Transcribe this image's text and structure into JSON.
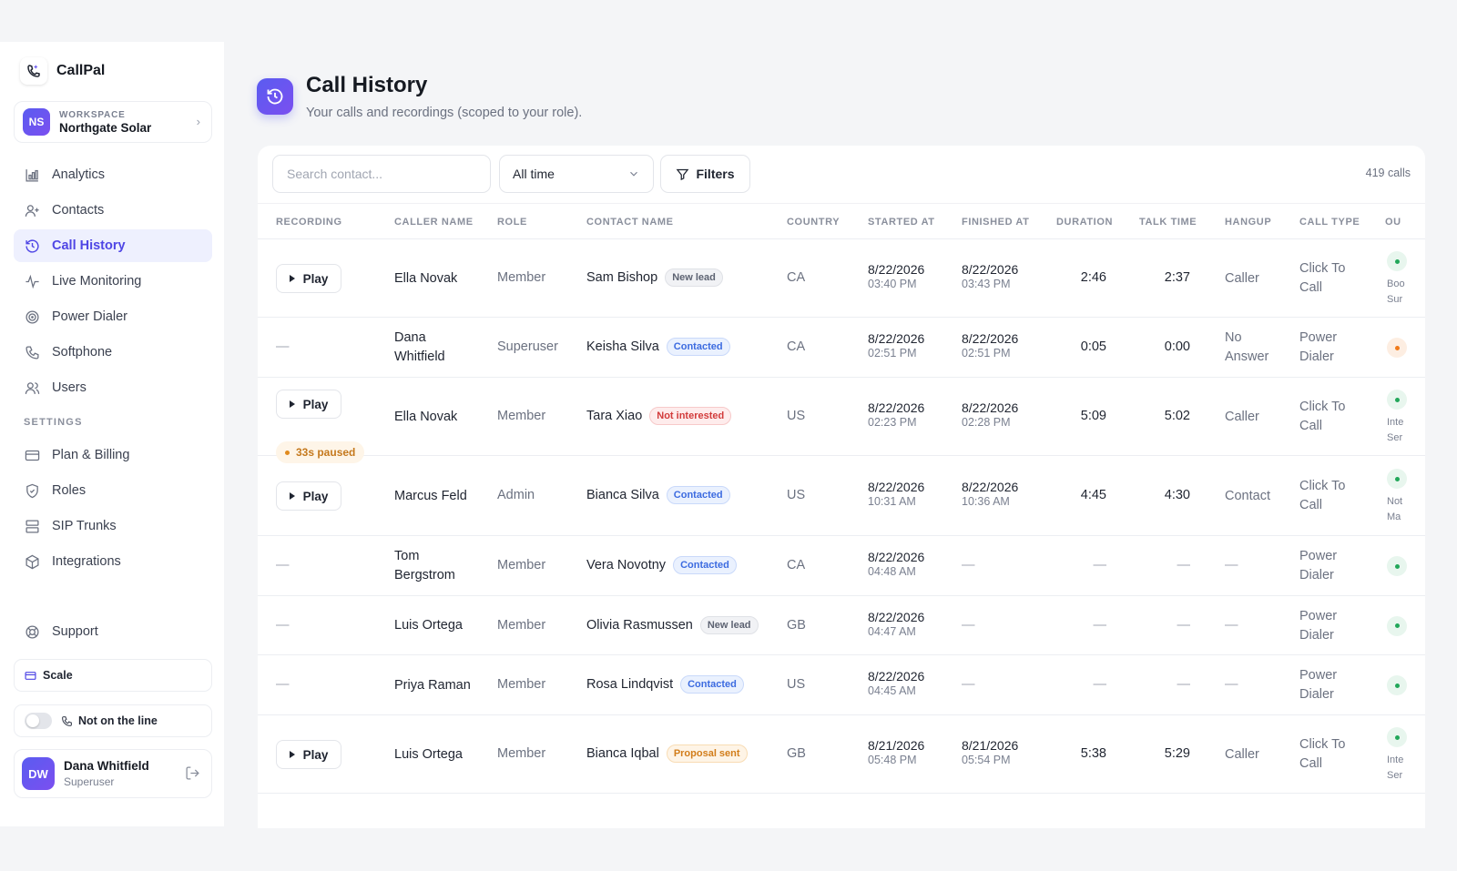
{
  "app": {
    "name": "CallPal"
  },
  "workspace": {
    "label": "WORKSPACE",
    "name": "Northgate Solar",
    "initials": "NS"
  },
  "nav": [
    {
      "label": "Analytics",
      "icon": "bar-chart-icon"
    },
    {
      "label": "Contacts",
      "icon": "user-plus-icon"
    },
    {
      "label": "Call History",
      "icon": "history-icon",
      "active": true
    },
    {
      "label": "Live Monitoring",
      "icon": "activity-icon"
    },
    {
      "label": "Power Dialer",
      "icon": "target-icon"
    },
    {
      "label": "Softphone",
      "icon": "phone-icon"
    },
    {
      "label": "Users",
      "icon": "users-icon"
    }
  ],
  "settings_label": "SETTINGS",
  "settings_nav": [
    {
      "label": "Plan & Billing",
      "icon": "credit-card-icon"
    },
    {
      "label": "Roles",
      "icon": "shield-icon"
    },
    {
      "label": "SIP Trunks",
      "icon": "server-icon"
    },
    {
      "label": "Integrations",
      "icon": "box-icon"
    }
  ],
  "support": {
    "label": "Support"
  },
  "plan": {
    "label": "Scale"
  },
  "status": {
    "label": "Not on the line"
  },
  "user": {
    "initials": "DW",
    "name": "Dana Whitfield",
    "role": "Superuser"
  },
  "header": {
    "title": "Call History",
    "subtitle": "Your calls and recordings (scoped to your role)."
  },
  "toolbar": {
    "search_placeholder": "Search contact...",
    "time_filter": "All time",
    "filters_label": "Filters",
    "count": "419 calls"
  },
  "columns": [
    "RECORDING",
    "CALLER NAME",
    "ROLE",
    "CONTACT NAME",
    "COUNTRY",
    "STARTED AT",
    "FINISHED AT",
    "DURATION",
    "TALK TIME",
    "HANGUP",
    "CALL TYPE",
    "OU"
  ],
  "play_label": "Play",
  "dash": "—",
  "rows": [
    {
      "recording": "play",
      "caller": [
        "Ella Novak"
      ],
      "role": "Member",
      "contact": "Sam Bishop",
      "badge": "New lead",
      "badge_kind": "new",
      "country": "CA",
      "started": [
        "8/22/2026",
        "03:40 PM"
      ],
      "finished": [
        "8/22/2026",
        "03:43 PM"
      ],
      "duration": "2:46",
      "talk": "2:37",
      "hangup": [
        "Caller"
      ],
      "type": [
        "Click To",
        "Call"
      ],
      "ou_dot": "#22a75a",
      "ou_text": [
        "Boo",
        "Sur"
      ]
    },
    {
      "recording": "none",
      "caller": [
        "Dana",
        "Whitfield"
      ],
      "role": "Superuser",
      "contact": "Keisha Silva",
      "badge": "Contacted",
      "badge_kind": "contacted",
      "country": "CA",
      "started": [
        "8/22/2026",
        "02:51 PM"
      ],
      "finished": [
        "8/22/2026",
        "02:51 PM"
      ],
      "duration": "0:05",
      "talk": "0:00",
      "hangup": [
        "No",
        "Answer"
      ],
      "type": [
        "Power",
        "Dialer"
      ],
      "ou_dot": "#f07a1a",
      "ou_text": []
    },
    {
      "recording": "play",
      "paused": "33s paused",
      "caller": [
        "Ella Novak"
      ],
      "role": "Member",
      "contact": "Tara Xiao",
      "badge": "Not interested",
      "badge_kind": "not",
      "country": "US",
      "started": [
        "8/22/2026",
        "02:23 PM"
      ],
      "finished": [
        "8/22/2026",
        "02:28 PM"
      ],
      "duration": "5:09",
      "talk": "5:02",
      "hangup": [
        "Caller"
      ],
      "type": [
        "Click To",
        "Call"
      ],
      "ou_dot": "#22a75a",
      "ou_text": [
        "Inte",
        "Ser"
      ]
    },
    {
      "recording": "play",
      "caller": [
        "Marcus Feld"
      ],
      "role": "Admin",
      "contact": "Bianca Silva",
      "badge": "Contacted",
      "badge_kind": "contacted",
      "country": "US",
      "started": [
        "8/22/2026",
        "10:31 AM"
      ],
      "finished": [
        "8/22/2026",
        "10:36 AM"
      ],
      "duration": "4:45",
      "talk": "4:30",
      "hangup": [
        "Contact"
      ],
      "type": [
        "Click To",
        "Call"
      ],
      "ou_dot": "#22a75a",
      "ou_text": [
        "Not",
        "Ma"
      ]
    },
    {
      "recording": "none",
      "caller": [
        "Tom",
        "Bergstrom"
      ],
      "role": "Member",
      "contact": "Vera Novotny",
      "badge": "Contacted",
      "badge_kind": "contacted",
      "country": "CA",
      "started": [
        "8/22/2026",
        "04:48 AM"
      ],
      "finished": null,
      "duration": null,
      "talk": null,
      "hangup": null,
      "type": [
        "Power",
        "Dialer"
      ],
      "ou_dot": "#22a75a",
      "ou_text": []
    },
    {
      "recording": "none",
      "caller": [
        "Luis Ortega"
      ],
      "role": "Member",
      "contact": "Olivia Rasmussen",
      "badge": "New lead",
      "badge_kind": "new",
      "country": "GB",
      "started": [
        "8/22/2026",
        "04:47 AM"
      ],
      "finished": null,
      "duration": null,
      "talk": null,
      "hangup": null,
      "type": [
        "Power",
        "Dialer"
      ],
      "ou_dot": "#22a75a",
      "ou_text": []
    },
    {
      "recording": "none",
      "caller": [
        "Priya Raman"
      ],
      "role": "Member",
      "contact": "Rosa Lindqvist",
      "badge": "Contacted",
      "badge_kind": "contacted",
      "country": "US",
      "started": [
        "8/22/2026",
        "04:45 AM"
      ],
      "finished": null,
      "duration": null,
      "talk": null,
      "hangup": null,
      "type": [
        "Power",
        "Dialer"
      ],
      "ou_dot": "#22a75a",
      "ou_text": []
    },
    {
      "recording": "play",
      "caller": [
        "Luis Ortega"
      ],
      "role": "Member",
      "contact": "Bianca Iqbal",
      "badge": "Proposal sent",
      "badge_kind": "proposal",
      "country": "GB",
      "started": [
        "8/21/2026",
        "05:48 PM"
      ],
      "finished": [
        "8/21/2026",
        "05:54 PM"
      ],
      "duration": "5:38",
      "talk": "5:29",
      "hangup": [
        "Caller"
      ],
      "type": [
        "Click To",
        "Call"
      ],
      "ou_dot": "#22a75a",
      "ou_text": [
        "Inte",
        "Ser"
      ]
    }
  ]
}
